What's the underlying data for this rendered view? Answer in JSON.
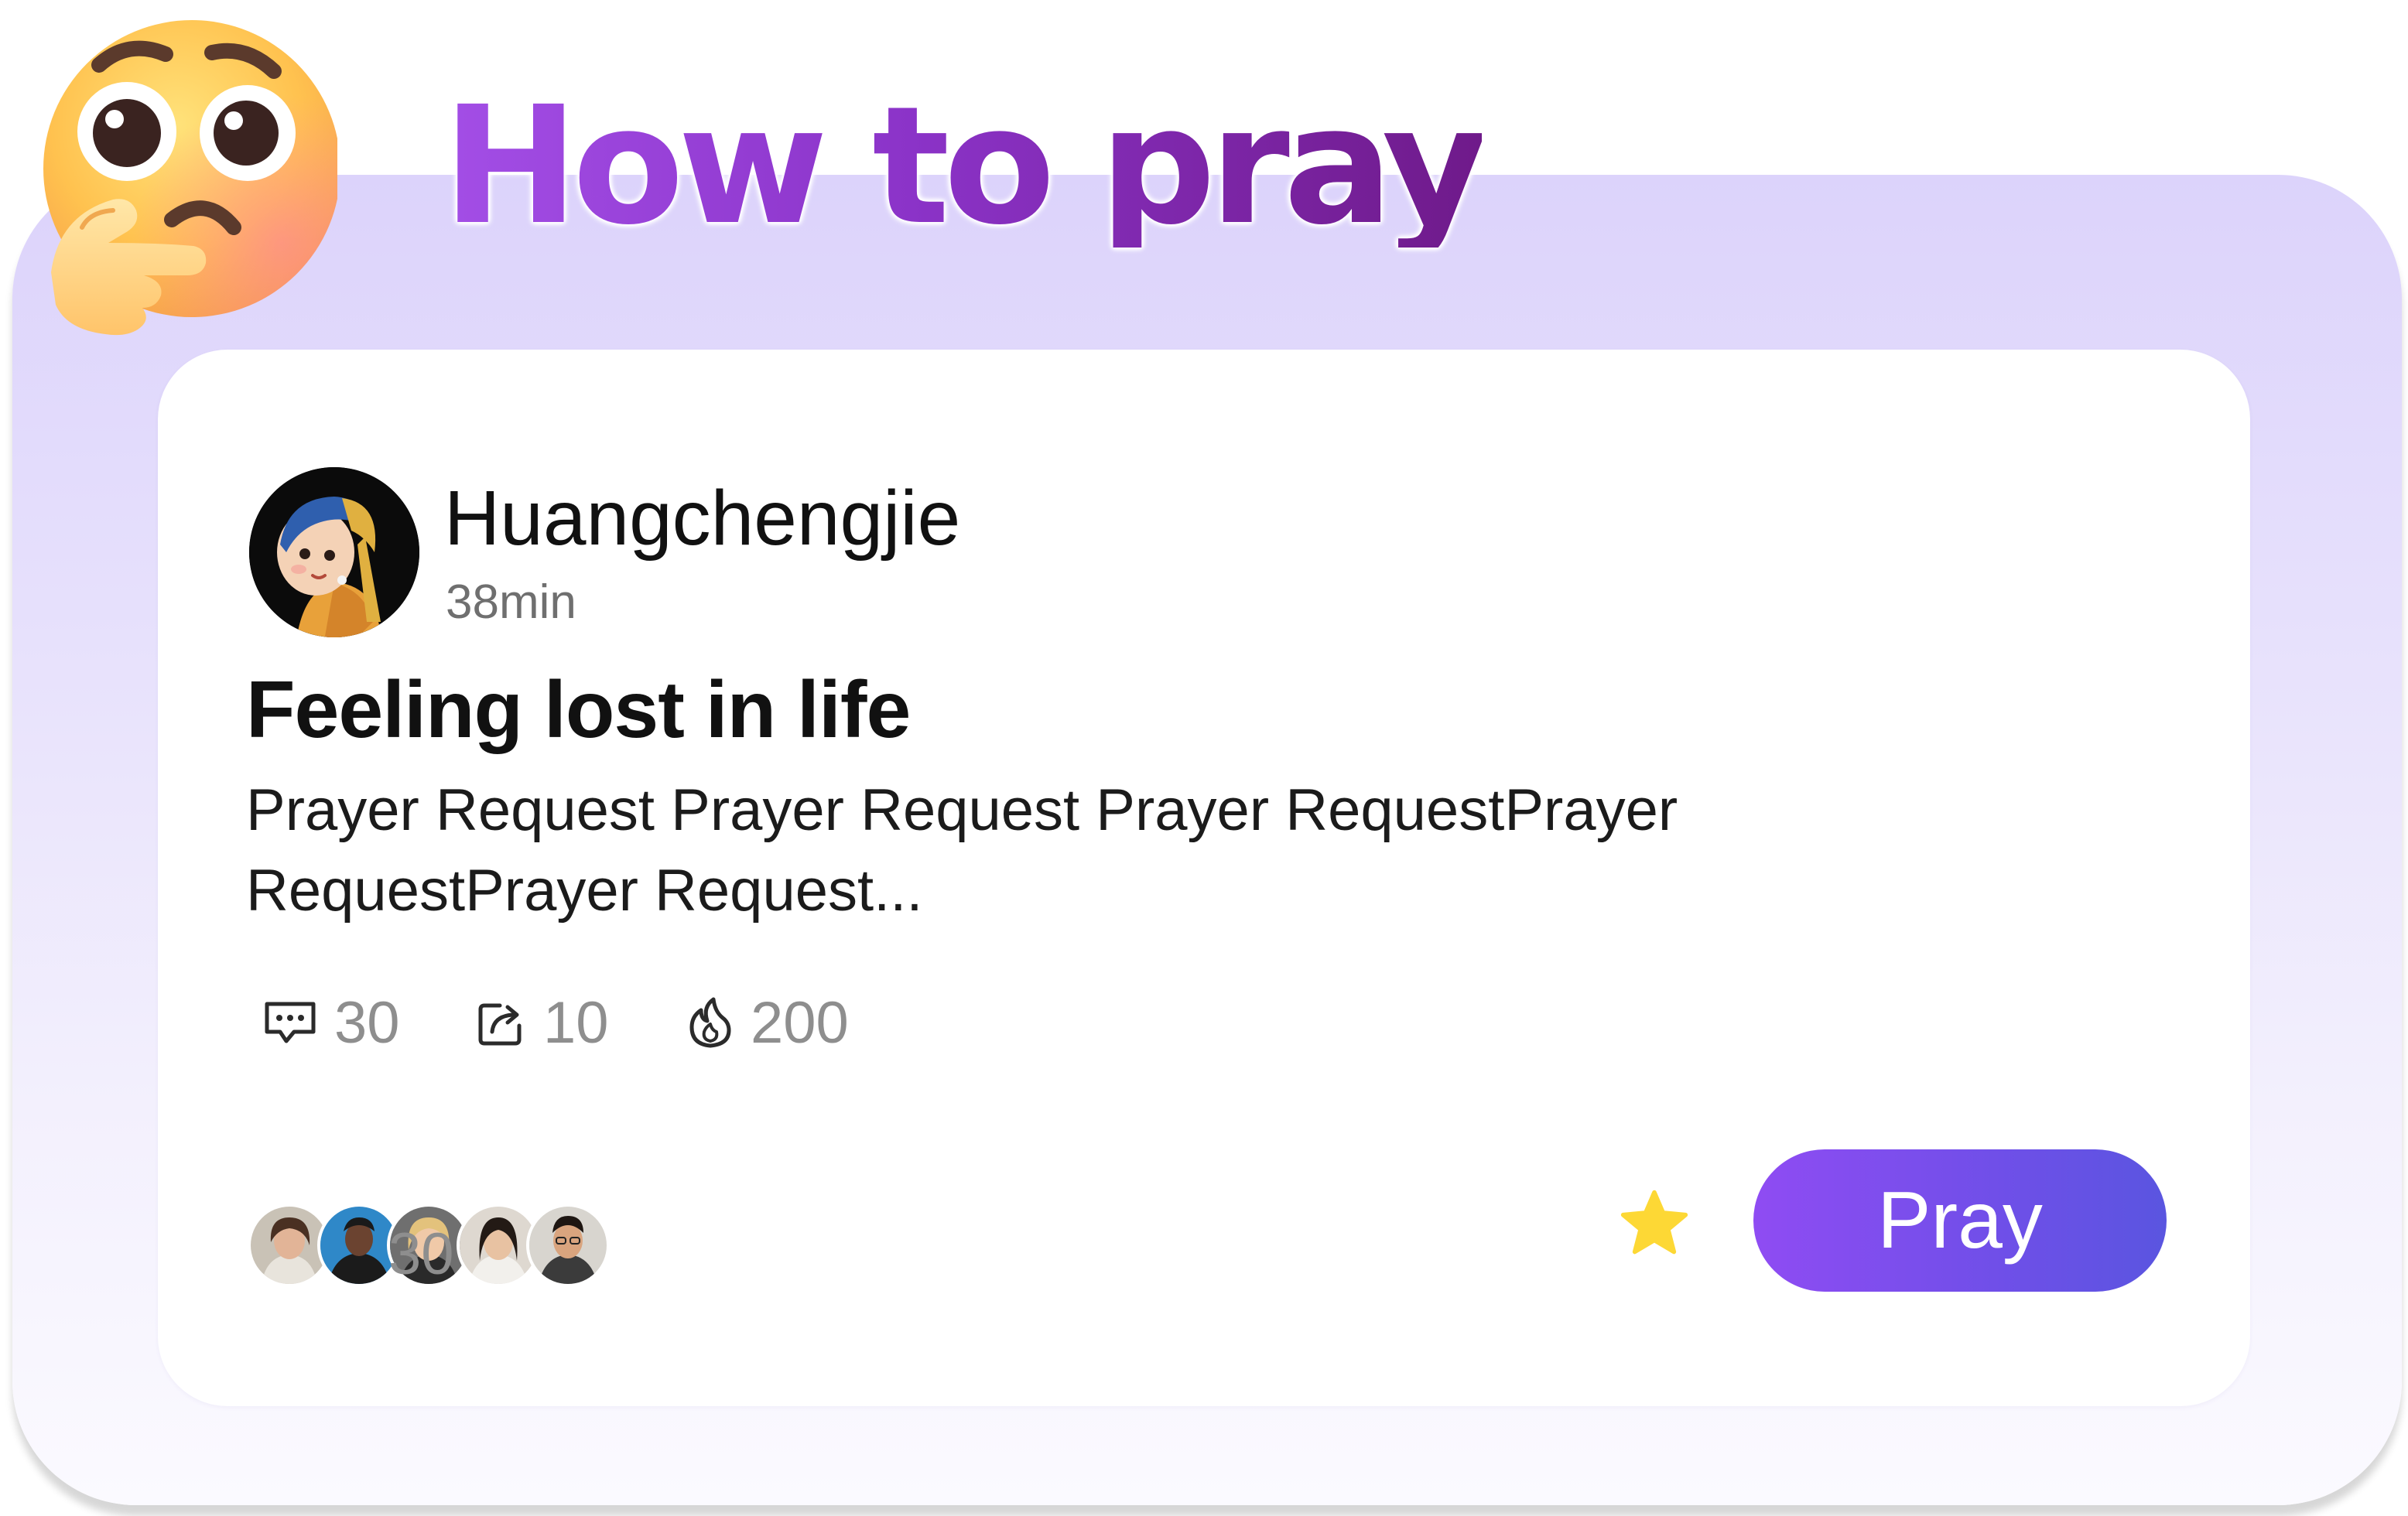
{
  "header": {
    "title": "How to pray",
    "emoji_icon": "thinking-face-icon"
  },
  "post": {
    "author": {
      "name": "Huangchengjie",
      "time": "38min",
      "avatar_icon": "girl-with-pearl-earring-avatar"
    },
    "title": "Feeling lost in life",
    "body": "Prayer Request  Prayer Request Prayer RequestPrayer\nRequestPrayer Request..."
  },
  "stats": [
    {
      "icon": "comment-icon",
      "value": "30"
    },
    {
      "icon": "share-icon",
      "value": "10"
    },
    {
      "icon": "fire-icon",
      "value": "200"
    }
  ],
  "participants": {
    "count": "30",
    "avatars": [
      "participant-1",
      "participant-2",
      "participant-3",
      "participant-4",
      "participant-5"
    ]
  },
  "actions": {
    "favorite_icon": "star-icon",
    "pray_label": "Pray"
  },
  "colors": {
    "accent": "#8f4cf3",
    "panel": "#dcd3fb",
    "title_gradient_start": "#a34ee6",
    "title_gradient_end": "#6f1a8a",
    "star": "#fdd835"
  }
}
